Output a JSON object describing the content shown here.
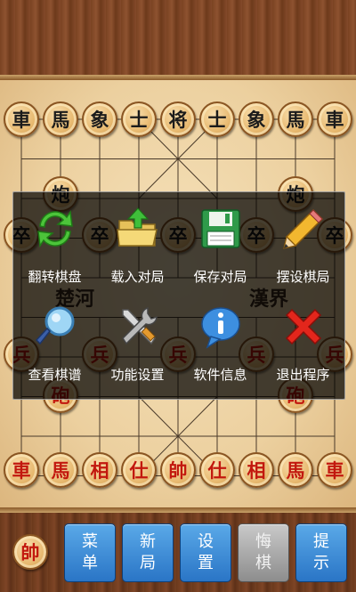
{
  "board": {
    "top_row": [
      "車",
      "馬",
      "象",
      "士",
      "将",
      "士",
      "象",
      "馬",
      "車"
    ],
    "bottom_row": [
      "車",
      "馬",
      "相",
      "仕",
      "帥",
      "仕",
      "相",
      "馬",
      "車"
    ],
    "black_cannons": [
      "炮",
      "炮"
    ],
    "black_soldiers": [
      "卒",
      "卒",
      "卒",
      "卒",
      "卒"
    ],
    "red_soldiers": [
      "兵",
      "兵",
      "兵",
      "兵",
      "兵"
    ],
    "red_cannons": [
      "砲",
      "砲"
    ],
    "river_left": "楚河",
    "river_right": "漢界"
  },
  "menu": {
    "items": [
      {
        "label": "翻转棋盘",
        "icon": "refresh-arrows-icon"
      },
      {
        "label": "载入对局",
        "icon": "open-folder-icon"
      },
      {
        "label": "保存对局",
        "icon": "floppy-disk-icon"
      },
      {
        "label": "摆设棋局",
        "icon": "pencil-icon"
      },
      {
        "label": "查看棋谱",
        "icon": "magnifier-icon"
      },
      {
        "label": "功能设置",
        "icon": "tools-icon"
      },
      {
        "label": "软件信息",
        "icon": "info-bubble-icon"
      },
      {
        "label": "退出程序",
        "icon": "red-x-icon"
      }
    ]
  },
  "toolbar": {
    "current_turn_piece": "帥",
    "buttons": [
      {
        "line1": "菜",
        "line2": "单",
        "state": "enabled"
      },
      {
        "line1": "新",
        "line2": "局",
        "state": "enabled"
      },
      {
        "line1": "设",
        "line2": "置",
        "state": "enabled"
      },
      {
        "line1": "悔",
        "line2": "棋",
        "state": "disabled"
      },
      {
        "line1": "提",
        "line2": "示",
        "state": "enabled"
      }
    ]
  },
  "colors": {
    "red_piece": "#c2180e",
    "black_piece": "#1b1b1b",
    "button_blue": "#2a75c6",
    "button_disabled": "#8d8d8d"
  }
}
